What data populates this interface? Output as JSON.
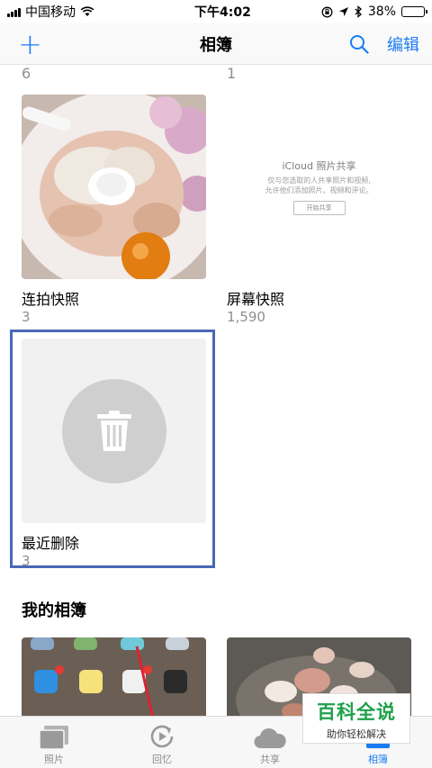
{
  "status_bar": {
    "carrier": "中国移动",
    "time": "下午4:02",
    "battery": "38%",
    "battery_level": 0.38
  },
  "nav": {
    "title": "相簿",
    "edit_label": "编辑"
  },
  "albums_top_counts": [
    "6",
    "1"
  ],
  "albums": [
    {
      "name": "连拍快照",
      "count": "3"
    },
    {
      "name": "屏幕快照",
      "count": "1,590"
    },
    {
      "name": "最近删除",
      "count": "3"
    }
  ],
  "icloud_card": {
    "title": "iCloud 照片共享",
    "desc_line1": "仅与您选取的人共享照片和视频,",
    "desc_line2": "允许他们添加照片、视频和评论。",
    "button": "开始共享"
  },
  "section": {
    "my_albums": "我的相簿"
  },
  "tabbar": {
    "tabs": [
      {
        "label": "照片",
        "icon": "photos-icon",
        "active": false
      },
      {
        "label": "回忆",
        "icon": "memories-icon",
        "active": false
      },
      {
        "label": "共享",
        "icon": "cloud-icon",
        "active": false
      },
      {
        "label": "相簿",
        "icon": "albums-icon",
        "active": true
      }
    ]
  },
  "watermark": {
    "line1": "百科全说",
    "line2": "助你轻松解决"
  },
  "colors": {
    "accent": "#1a7cf5",
    "highlight_border": "#4a68b5",
    "watermark_green": "#1fa04a"
  }
}
